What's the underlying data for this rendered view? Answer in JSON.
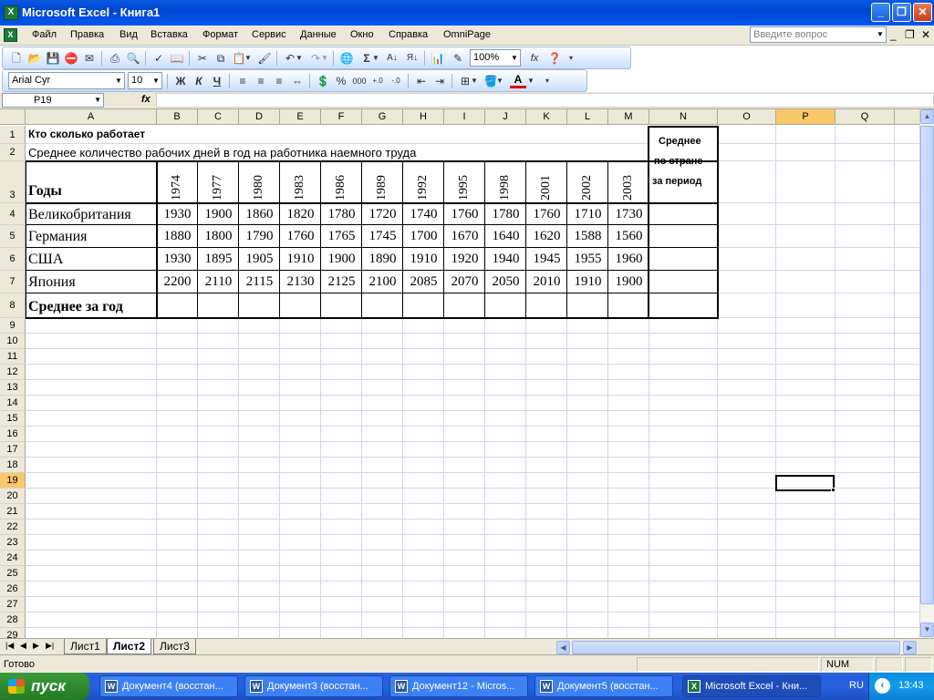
{
  "window": {
    "title": "Microsoft Excel - Книга1",
    "app_icon": "excel-icon"
  },
  "menu": {
    "items": [
      "Файл",
      "Правка",
      "Вид",
      "Вставка",
      "Формат",
      "Сервис",
      "Данные",
      "Окно",
      "Справка",
      "OmniPage"
    ],
    "help_placeholder": "Введите вопрос"
  },
  "toolbar": {
    "zoom": "100%",
    "font_name": "Arial Cyr",
    "font_size": "10",
    "bold": "Ж",
    "italic": "К",
    "underline": "Ч",
    "sigma": "Σ",
    "percent": "%",
    "thousands": "000"
  },
  "formula_bar": {
    "name_box": "P19",
    "fx": "fx",
    "content": ""
  },
  "grid": {
    "columns": [
      "A",
      "B",
      "C",
      "D",
      "E",
      "F",
      "G",
      "H",
      "I",
      "J",
      "K",
      "L",
      "M",
      "N",
      "O",
      "P",
      "Q"
    ],
    "selected_column": "P",
    "selected_row": 19,
    "rows": [
      "1",
      "2",
      "3",
      "4",
      "5",
      "6",
      "7",
      "8",
      "9",
      "10",
      "11",
      "12",
      "13",
      "14",
      "15",
      "16",
      "17",
      "18",
      "19",
      "20",
      "21",
      "22",
      "23",
      "24",
      "25",
      "26",
      "27",
      "28",
      "29"
    ]
  },
  "sheet": {
    "title": "Кто сколько работает",
    "subtitle": "Среднее количество рабочих дней в год на работника наемного труда",
    "header_label": "Годы",
    "years": [
      "1974",
      "1977",
      "1980",
      "1983",
      "1986",
      "1989",
      "1992",
      "1995",
      "1998",
      "2001",
      "2002",
      "2003"
    ],
    "avg_header": [
      "Среднее",
      "по стране",
      "за период"
    ],
    "countries": [
      {
        "name": "Великобритания",
        "values": [
          "1930",
          "1900",
          "1860",
          "1820",
          "1780",
          "1720",
          "1740",
          "1760",
          "1780",
          "1760",
          "1710",
          "1730"
        ]
      },
      {
        "name": "Германия",
        "values": [
          "1880",
          "1800",
          "1790",
          "1760",
          "1765",
          "1745",
          "1700",
          "1670",
          "1640",
          "1620",
          "1588",
          "1560"
        ]
      },
      {
        "name": "США",
        "values": [
          "1930",
          "1895",
          "1905",
          "1910",
          "1900",
          "1890",
          "1910",
          "1920",
          "1940",
          "1945",
          "1955",
          "1960"
        ]
      },
      {
        "name": "Япония",
        "values": [
          "2200",
          "2110",
          "2115",
          "2130",
          "2125",
          "2100",
          "2085",
          "2070",
          "2050",
          "2010",
          "1910",
          "1900"
        ]
      }
    ],
    "avg_row_label": "Среднее за год"
  },
  "tabs": {
    "items": [
      "Лист1",
      "Лист2",
      "Лист3"
    ],
    "active": "Лист2"
  },
  "status": {
    "text": "Готово",
    "num": "NUM"
  },
  "taskbar": {
    "start": "пуск",
    "tasks": [
      "Документ4 (восстан...",
      "Документ3 (восстан...",
      "Документ12 - Micros...",
      "Документ5 (восстан...",
      "Microsoft Excel - Кни..."
    ],
    "lang": "RU",
    "clock": "13:43"
  }
}
